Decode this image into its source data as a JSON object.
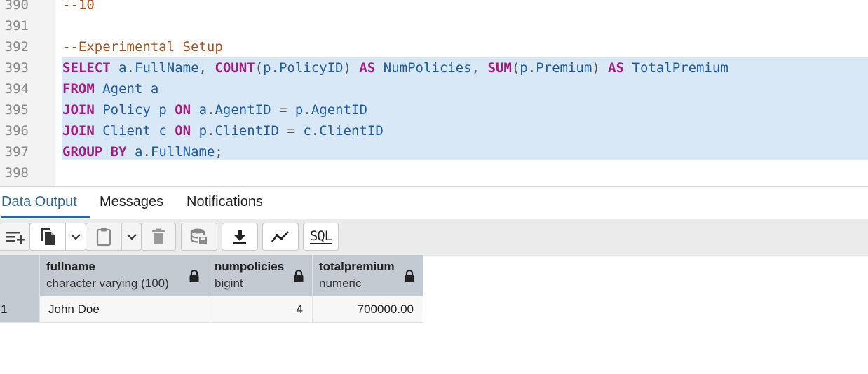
{
  "editor": {
    "lines": [
      {
        "num": "390",
        "text": "--10"
      },
      {
        "num": "391",
        "text": ""
      },
      {
        "num": "392",
        "text": "--Experimental Setup"
      },
      {
        "num": "393",
        "text": "SELECT a.FullName, COUNT(p.PolicyID) AS NumPolicies, SUM(p.Premium) AS TotalPremium"
      },
      {
        "num": "394",
        "text": "FROM Agent a"
      },
      {
        "num": "395",
        "text": "JOIN Policy p ON a.AgentID = p.AgentID"
      },
      {
        "num": "396",
        "text": "JOIN Client c ON p.ClientID = c.ClientID"
      },
      {
        "num": "397",
        "text": "GROUP BY a.FullName;"
      },
      {
        "num": "398",
        "text": ""
      }
    ],
    "selected_lines": [
      "393",
      "394",
      "395",
      "396",
      "397"
    ]
  },
  "tabs": [
    {
      "label": "Data Output",
      "active": true
    },
    {
      "label": "Messages",
      "active": false
    },
    {
      "label": "Notifications",
      "active": false
    }
  ],
  "toolbar": {
    "buttons": [
      {
        "icon": "add-row-icon"
      },
      {
        "icon": "copy-icon"
      },
      {
        "icon": "chevron-down-icon"
      },
      {
        "icon": "paste-icon"
      },
      {
        "icon": "chevron-down-icon"
      },
      {
        "icon": "delete-icon"
      },
      {
        "icon": "save-data-icon"
      },
      {
        "icon": "download-icon"
      },
      {
        "icon": "graph-icon"
      },
      {
        "icon": "sql-icon",
        "label": "SQL"
      }
    ]
  },
  "grid": {
    "columns": [
      {
        "name": "fullname",
        "type": "character varying (100)"
      },
      {
        "name": "numpolicies",
        "type": "bigint"
      },
      {
        "name": "totalpremium",
        "type": "numeric"
      }
    ],
    "rows": [
      {
        "index": "1",
        "cells": [
          "John Doe",
          "4",
          "700000.00"
        ]
      }
    ]
  },
  "colors": {
    "selection": "#d9e8f6",
    "keyword": "#9c1f7f",
    "identifier": "#1f5b9e",
    "comment": "#a0521c",
    "active_tab": "#326690",
    "header_bg": "#c4cad2"
  }
}
